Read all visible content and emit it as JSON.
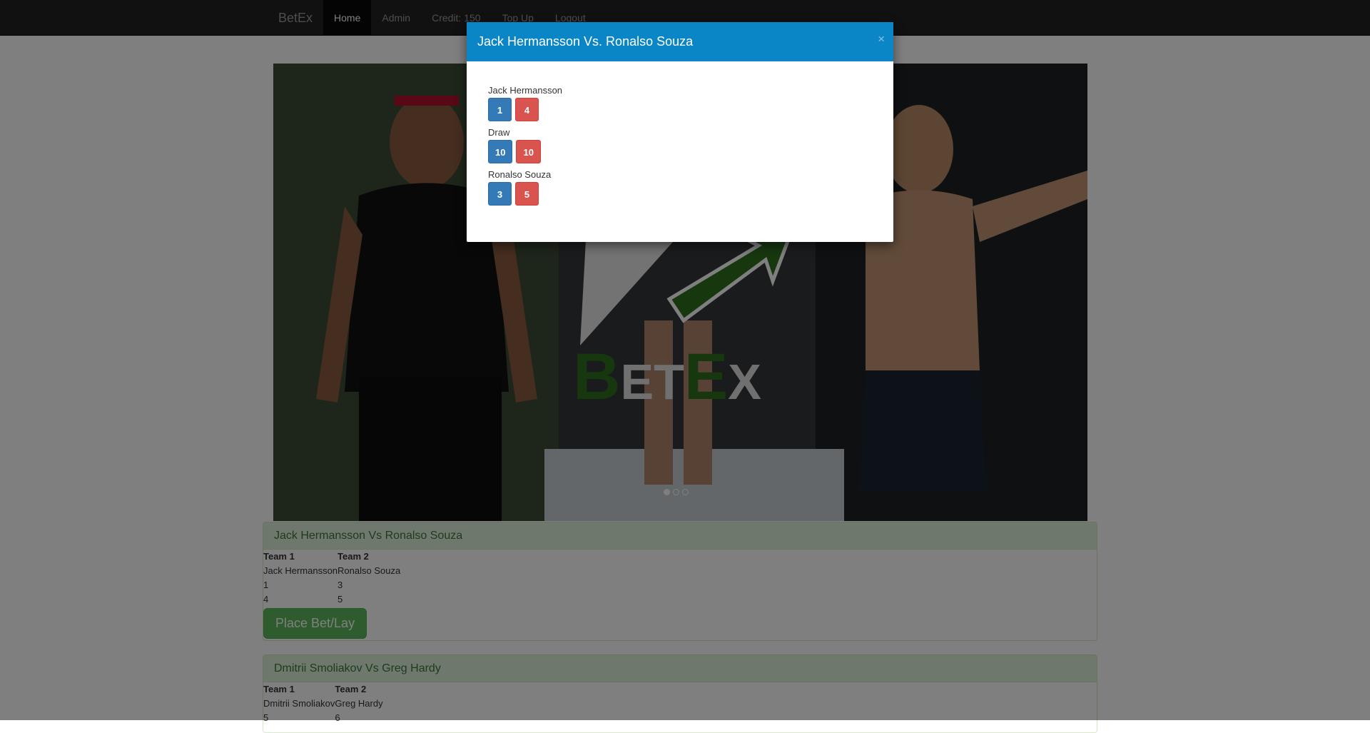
{
  "navbar": {
    "brand": "BetEx",
    "links": [
      "Home",
      "Admin",
      "Credit: 150",
      "Top Up",
      "Logout"
    ]
  },
  "hero": {
    "logo_text": "BETEX",
    "slides": 3,
    "active_slide": 1
  },
  "matches": [
    {
      "title": "Jack Hermansson Vs Ronalso Souza",
      "col_headers": [
        "Team 1",
        "Team 2"
      ],
      "names": [
        "Jack Hermansson",
        "Ronalso Souza"
      ],
      "back": [
        "1",
        "3"
      ],
      "lay": [
        "4",
        "5"
      ],
      "button": "Place Bet/Lay"
    },
    {
      "title": "Dmitrii Smoliakov Vs Greg Hardy",
      "col_headers": [
        "Team 1",
        "Team 2"
      ],
      "names": [
        "Dmitrii Smoliakov",
        "Greg Hardy"
      ],
      "back": [
        "5",
        "6"
      ]
    }
  ],
  "modal": {
    "title": "Jack Hermansson Vs. Ronalso Souza",
    "close": "×",
    "selections": [
      {
        "label": "Jack Hermansson",
        "back": "1",
        "lay": "4"
      },
      {
        "label": "Draw",
        "back": "10",
        "lay": "10"
      },
      {
        "label": "Ronalso Souza",
        "back": "3",
        "lay": "5"
      }
    ]
  },
  "colors": {
    "navbar": "#222222",
    "modal_header": "#0a85c6",
    "back_button": "#337ab7",
    "lay_button": "#d9534f",
    "panel_heading": "#dff0d8",
    "success_button": "#5cb85c",
    "logo_green": "#2e6e1f"
  }
}
